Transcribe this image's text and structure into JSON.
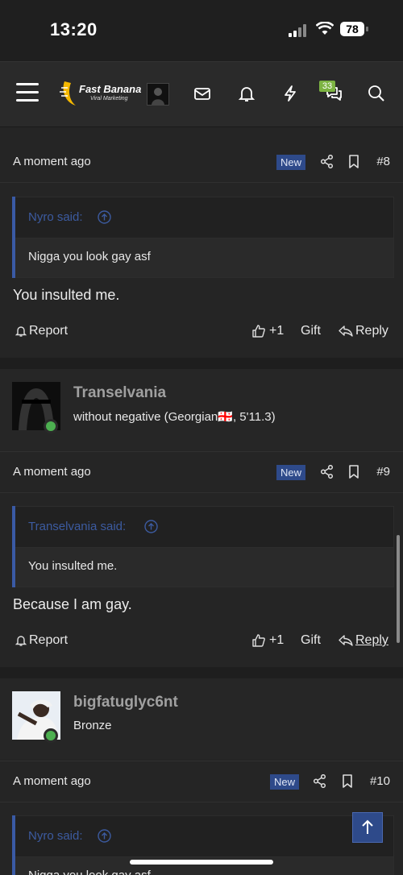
{
  "status": {
    "time": "13:20",
    "battery": "78"
  },
  "nav": {
    "logo_name": "Fast Banana",
    "logo_sub": "Viral Marketing",
    "conversations_badge": "33",
    "icons": [
      "menu-icon",
      "inbox-icon",
      "bell-icon",
      "bolt-icon",
      "chat-icon",
      "search-icon"
    ]
  },
  "posts": [
    {
      "time_ago": "A moment ago",
      "new_tag": "New",
      "number": "#8",
      "quote_author": "Nyro said:",
      "quote_text": "Nigga you look gay asf",
      "message": "You insulted me.",
      "report": "Report",
      "like": "+1",
      "gift": "Gift",
      "reply": "Reply"
    },
    {
      "time_ago": "A moment ago",
      "new_tag": "New",
      "number": "#9",
      "quote_author": "Transelvania said:",
      "quote_text": "You insulted me.",
      "message": "Because I am gay.",
      "report": "Report",
      "like": "+1",
      "gift": "Gift",
      "reply": "Reply"
    },
    {
      "time_ago": "A moment ago",
      "new_tag": "New",
      "number": "#10",
      "quote_author": "Nyro said:",
      "quote_text": "Nigga you look gay asf"
    }
  ],
  "users": [
    {
      "name": "Transelvania",
      "title": "without negative (Georgian🇬🇪, 5'11.3)"
    },
    {
      "name": "bigfatuglyc6nt",
      "title": "Bronze"
    }
  ],
  "colors": {
    "accent": "#2e4a8a",
    "quote_author": "#3c5ba0",
    "online": "#4caf50",
    "badge": "#7cb342"
  }
}
